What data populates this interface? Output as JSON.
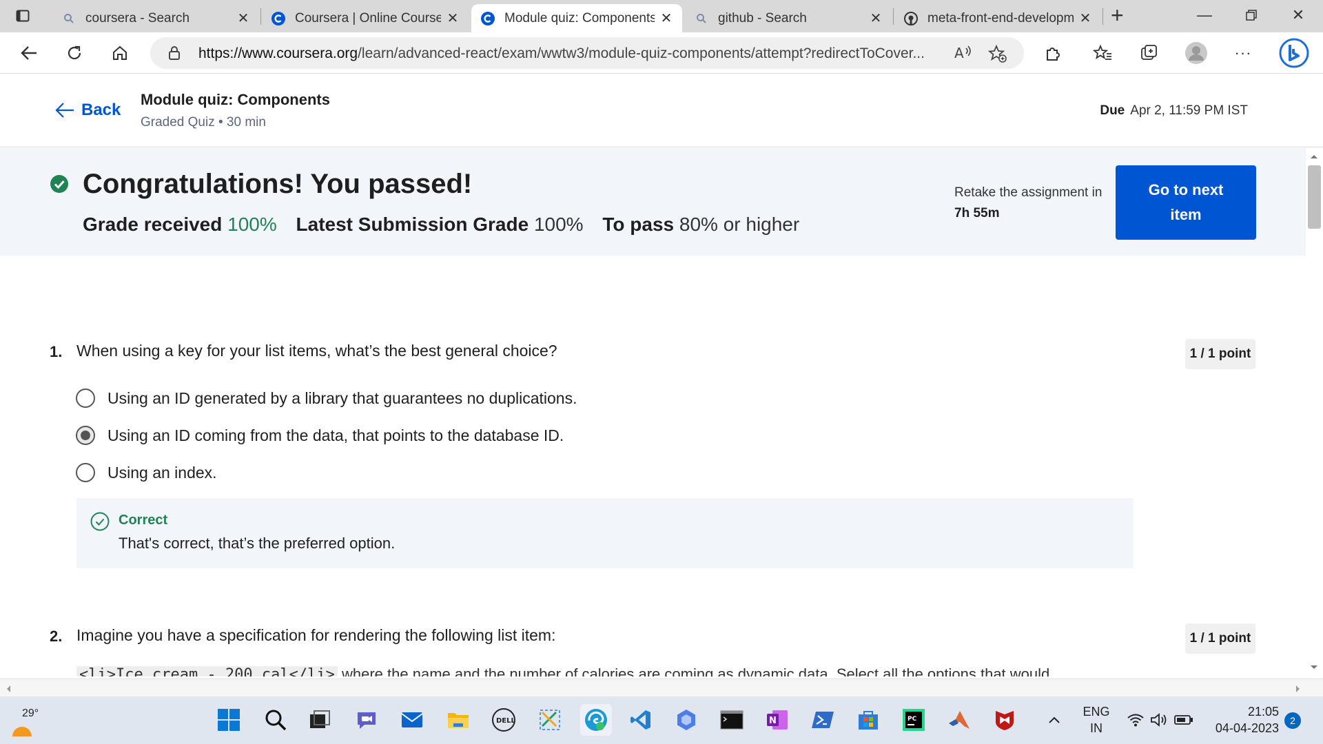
{
  "browser": {
    "tabs": [
      {
        "title": "coursera - Search",
        "icon": "search-icon"
      },
      {
        "title": "Coursera | Online Courses",
        "icon": "coursera-icon"
      },
      {
        "title": "Module quiz: Components",
        "icon": "coursera-icon",
        "active": true
      },
      {
        "title": "github - Search",
        "icon": "search-icon"
      },
      {
        "title": "meta-front-end-developm",
        "icon": "github-icon"
      }
    ],
    "url_domain": "https://www.coursera.org",
    "url_path": "/learn/advanced-react/exam/wwtw3/module-quiz-components/attempt?redirectToCover..."
  },
  "header": {
    "back_label": "Back",
    "quiz_title": "Module quiz: Components",
    "quiz_subtitle": "Graded Quiz • 30 min",
    "due_label": "Due",
    "due_value": "Apr 2, 11:59 PM IST"
  },
  "banner": {
    "headline": "Congratulations! You passed!",
    "grade_label": "Grade received",
    "grade_value": "100%",
    "latest_label": "Latest Submission Grade",
    "latest_value": "100%",
    "pass_label": "To pass",
    "pass_value": "80% or higher",
    "retake_label": "Retake the assignment in",
    "retake_time": "7h 55m",
    "next_button": "Go to next item"
  },
  "questions": [
    {
      "number": "1.",
      "text": "When using a key for your list items, what’s the best general choice?",
      "points": "1 / 1 point",
      "options": [
        "Using an ID generated by a library that guarantees no duplications.",
        "Using an ID coming from the data, that points to the database ID.",
        "Using an index."
      ],
      "selected_index": 1,
      "feedback_label": "Correct",
      "feedback_text": "That's correct, that’s the preferred option."
    },
    {
      "number": "2.",
      "text": "Imagine you have a specification for rendering the following list item:",
      "points": "1 / 1 point",
      "code": "<li>Ice cream - 200 cal</li>",
      "partial_text": "where the name and the number of calories are coming as dynamic data. Select all the options that would"
    }
  ],
  "taskbar": {
    "temperature": "29°",
    "lang_top": "ENG",
    "lang_bottom": "IN",
    "time": "21:05",
    "date": "04-04-2023",
    "notifications": "2"
  },
  "colors": {
    "accent": "#0056d2",
    "success": "#1f8354",
    "banner_bg": "#f2f5fa"
  }
}
